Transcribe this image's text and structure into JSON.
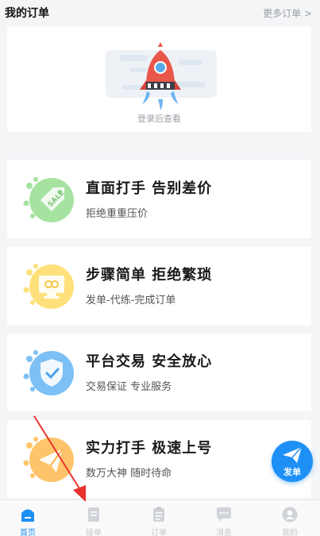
{
  "orders": {
    "title": "我的订单",
    "more_label": "更多订单 >",
    "empty_hint": "登录后查看"
  },
  "features": [
    {
      "title": "直面打手 告别差价",
      "subtitle": "拒绝重重压价",
      "color": "#a6e3a1",
      "icon": "price-tag-icon"
    },
    {
      "title": "步骤简单 拒绝繁琐",
      "subtitle": "发单-代练-完成订单",
      "color": "#ffe07a",
      "icon": "monitor-link-icon"
    },
    {
      "title": "平台交易 安全放心",
      "subtitle": "交易保证 专业服务",
      "color": "#7cc0f5",
      "icon": "shield-check-icon"
    },
    {
      "title": "实力打手 极速上号",
      "subtitle": "数万大神 随时待命",
      "color": "#ffc46b",
      "icon": "paper-plane-icon"
    }
  ],
  "fab": {
    "label": "发单",
    "color": "#1e90f5"
  },
  "tabbar": {
    "items": [
      {
        "label": "首页",
        "icon": "home-icon",
        "active": true
      },
      {
        "label": "接单",
        "icon": "document-icon",
        "active": false
      },
      {
        "label": "订单",
        "icon": "clipboard-icon",
        "active": false
      },
      {
        "label": "消息",
        "icon": "chat-bubble-icon",
        "active": false
      },
      {
        "label": "我的",
        "icon": "user-icon",
        "active": false
      }
    ]
  },
  "colors": {
    "accent": "#1e90f5",
    "inactive": "#c4c7cc",
    "annotation_arrow": "#e8322b"
  }
}
